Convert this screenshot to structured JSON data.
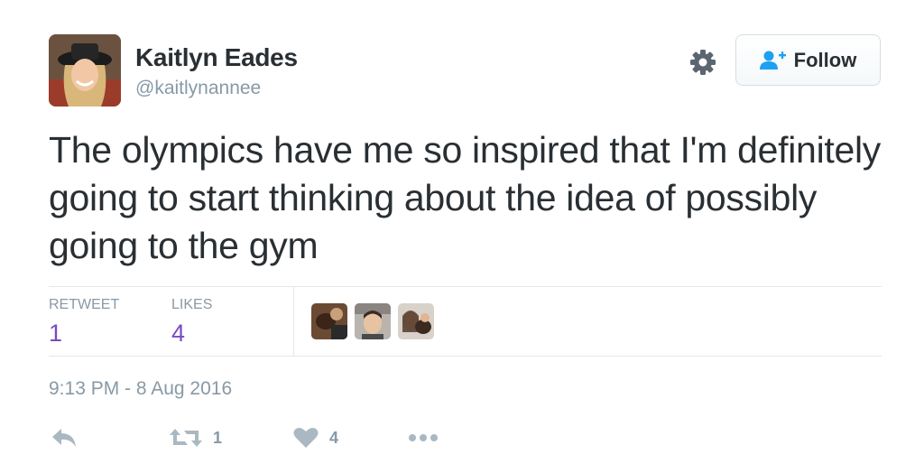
{
  "user": {
    "display_name": "Kaitlyn Eades",
    "handle": "@kaitlynannee"
  },
  "header": {
    "follow_label": "Follow",
    "settings_icon": "gear-icon",
    "follow_icon": "add-user-icon"
  },
  "tweet": {
    "text": "The olympics have me so inspired that I'm definitely going to start thinking about the idea of possibly going to the gym",
    "timestamp": "9:13 PM - 8 Aug 2016"
  },
  "stats": {
    "retweets_label": "RETWEET",
    "retweets_count": "1",
    "likes_label": "LIKES",
    "likes_count": "4"
  },
  "actions": {
    "reply_icon": "reply-icon",
    "retweet_icon": "retweet-icon",
    "retweet_count": "1",
    "like_icon": "heart-icon",
    "like_count": "4",
    "more_icon": "more-icon"
  },
  "colors": {
    "text": "#292f33",
    "muted": "#8899a6",
    "stat_value": "#794bc4",
    "follow_icon": "#1da1f2",
    "divider": "#e1e8ed"
  }
}
